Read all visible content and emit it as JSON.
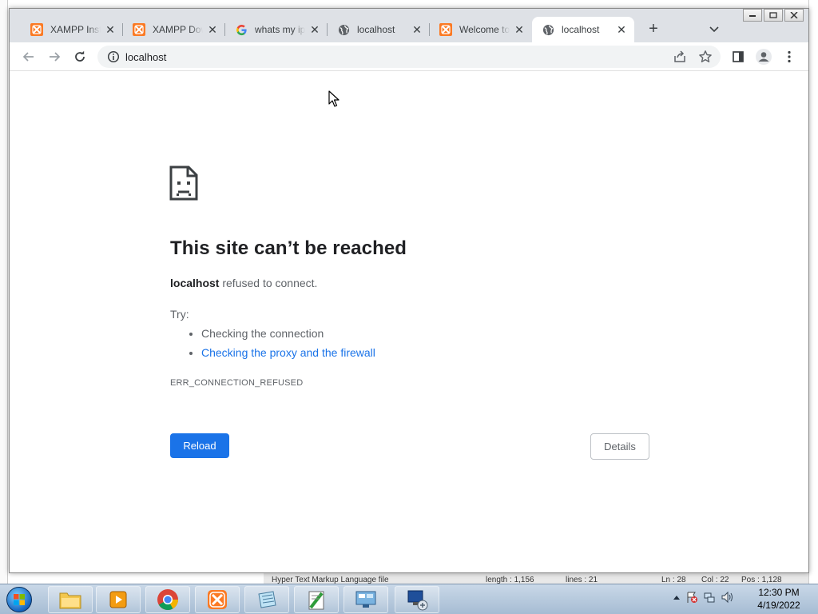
{
  "tabs": [
    {
      "title": "XAMPP Installers and Downloads",
      "icon": "xampp-icon",
      "active": false
    },
    {
      "title": "XAMPP Downloads",
      "icon": "xampp-icon",
      "active": false
    },
    {
      "title": "whats my ip - Google Search",
      "icon": "google-icon",
      "active": false
    },
    {
      "title": "localhost",
      "icon": "globe-icon",
      "active": false
    },
    {
      "title": "Welcome to XAMPP",
      "icon": "xampp-icon",
      "active": false
    },
    {
      "title": "localhost",
      "icon": "globe-icon",
      "active": true
    }
  ],
  "toolbar": {
    "url": "localhost"
  },
  "error": {
    "title": "This site can’t be reached",
    "host": "localhost",
    "message": " refused to connect.",
    "try_label": "Try:",
    "suggestions": [
      "Checking the connection",
      "Checking the proxy and the firewall"
    ],
    "code": "ERR_CONNECTION_REFUSED",
    "reload_label": "Reload",
    "details_label": "Details"
  },
  "background_status": {
    "filetype": "Hyper Text Markup Language file",
    "length": "length : 1,156",
    "lines": "lines : 21",
    "ln": "Ln : 28",
    "col": "Col : 22",
    "pos": "Pos : 1,128"
  },
  "taskbar": {
    "apps": [
      "windows-explorer",
      "media-player",
      "google-chrome",
      "xampp-control-panel",
      "notepad",
      "notepad-plus-plus",
      "control-panel",
      "remote-desktop"
    ],
    "time": "12:30 PM",
    "date": "4/19/2022"
  },
  "colors": {
    "accent": "#1a73e8",
    "tabstrip": "#dee1e6",
    "xampp": "#fb7a24"
  }
}
